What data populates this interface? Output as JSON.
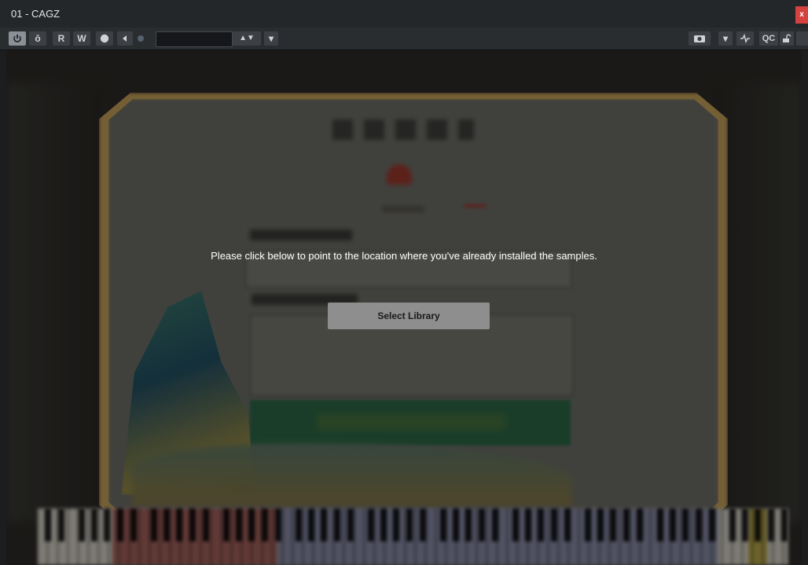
{
  "window": {
    "title": "01 - CAGZ",
    "close_label": "x"
  },
  "toolbar": {
    "power_icon": "power-icon",
    "compare_label": "ō",
    "read_label": "R",
    "write_label": "W",
    "preset_label": "a",
    "updown_label": "▲▼",
    "dropdown_label": "▾",
    "camera_icon": "camera-icon",
    "qc_label": "QC",
    "preset_value": ""
  },
  "overlay": {
    "message": "Please click below to point to the location where you've already installed the samples.",
    "button_label": "Select Library"
  },
  "colors": {
    "accent_close": "#d4413f",
    "overlay_button": "#8e8e8e"
  }
}
